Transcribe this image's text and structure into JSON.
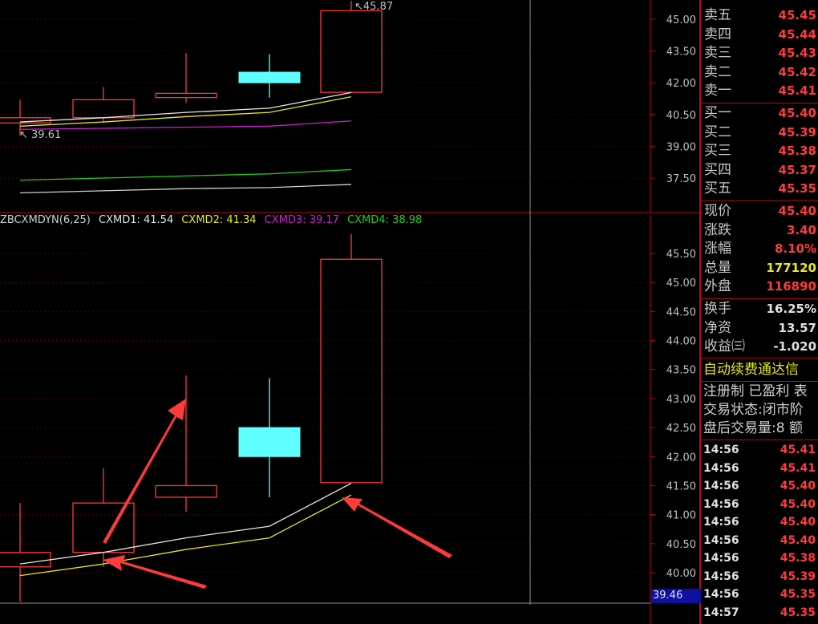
{
  "upper_chart": {
    "axis_ticks": [
      "45.00",
      "43.50",
      "42.00",
      "40.50",
      "39.00",
      "37.50"
    ],
    "high_label": "45.87",
    "low_label": "39.61"
  },
  "indicator": {
    "name": "ZBCXMDYN(6,25)",
    "series": [
      {
        "label": "CXMD1: 41.54",
        "color": "#e6e6e6"
      },
      {
        "label": "CXMD2: 41.34",
        "color": "#e8e818"
      },
      {
        "label": "CXMD3: 39.17",
        "color": "#d020d0"
      },
      {
        "label": "CXMD4: 38.98",
        "color": "#20d020"
      }
    ]
  },
  "lower_chart": {
    "axis_ticks": [
      "45.50",
      "45.00",
      "44.50",
      "44.00",
      "43.50",
      "43.00",
      "42.50",
      "42.00",
      "41.50",
      "41.00",
      "40.50",
      "40.00"
    ],
    "cursor_price": "39.46"
  },
  "chart_data": {
    "type": "candlestick",
    "candles": [
      {
        "open": 40.1,
        "close": 40.35,
        "high": 41.2,
        "low": 39.5,
        "color": "red"
      },
      {
        "open": 40.35,
        "close": 41.2,
        "high": 41.8,
        "low": 40.1,
        "color": "red"
      },
      {
        "open": 41.3,
        "close": 41.5,
        "high": 43.4,
        "low": 41.05,
        "color": "red"
      },
      {
        "open": 42.5,
        "close": 42.0,
        "high": 43.35,
        "low": 41.3,
        "color": "cyan"
      },
      {
        "open": 41.55,
        "close": 45.4,
        "high": 45.87,
        "low": 41.55,
        "color": "red"
      }
    ],
    "series": [
      {
        "name": "CXMD1",
        "values": [
          40.15,
          40.35,
          40.6,
          40.8,
          41.54
        ],
        "color": "#e6e6e6"
      },
      {
        "name": "CXMD2",
        "values": [
          39.95,
          40.15,
          40.4,
          40.6,
          41.34
        ],
        "color": "#e8e818"
      },
      {
        "name": "CXMD3",
        "values": [
          39.8,
          39.85,
          39.9,
          39.95,
          40.2
        ],
        "color": "#d020d0"
      },
      {
        "name": "CXMD4",
        "values": [
          37.4,
          37.5,
          37.6,
          37.7,
          37.9
        ],
        "color": "#20d020"
      },
      {
        "name": "",
        "values": [
          36.8,
          36.9,
          37.0,
          37.05,
          37.2
        ],
        "color": "#d0d0d0"
      }
    ],
    "upper_ylim": [
      37.0,
      46.0
    ],
    "lower_ylim": [
      39.7,
      45.9
    ]
  },
  "quotes": {
    "sell": [
      {
        "label": "卖五",
        "value": "45.45"
      },
      {
        "label": "卖四",
        "value": "45.44"
      },
      {
        "label": "卖三",
        "value": "45.43"
      },
      {
        "label": "卖二",
        "value": "45.42"
      },
      {
        "label": "卖一",
        "value": "45.41"
      }
    ],
    "buy": [
      {
        "label": "买一",
        "value": "45.40"
      },
      {
        "label": "买二",
        "value": "45.39"
      },
      {
        "label": "买三",
        "value": "45.38"
      },
      {
        "label": "买四",
        "value": "45.37"
      },
      {
        "label": "买五",
        "value": "45.35"
      }
    ],
    "stats1": [
      {
        "label": "现价",
        "value": "45.40",
        "color": "red"
      },
      {
        "label": "涨跌",
        "value": "3.40",
        "color": "red"
      },
      {
        "label": "涨幅",
        "value": "8.10%",
        "color": "red"
      },
      {
        "label": "总量",
        "value": "177120",
        "color": "yellow"
      },
      {
        "label": "外盘",
        "value": "116890",
        "color": "red"
      }
    ],
    "stats2": [
      {
        "label": "换手",
        "value": "16.25%",
        "color": "white"
      },
      {
        "label": "净资",
        "value": "13.57",
        "color": "white"
      },
      {
        "label": "收益㈢",
        "value": "-1.020",
        "color": "white"
      }
    ]
  },
  "info": {
    "promo": "自动续费通达信",
    "register": "注册制 已盈利 表",
    "trade_status": "交易状态:闭市阶",
    "after_hours": "盘后交易量:8 额"
  },
  "ticks": [
    {
      "time": "14:56",
      "price": "45.41"
    },
    {
      "time": "14:56",
      "price": "45.41"
    },
    {
      "time": "14:56",
      "price": "45.40"
    },
    {
      "time": "14:56",
      "price": "45.40"
    },
    {
      "time": "14:56",
      "price": "45.40"
    },
    {
      "time": "14:56",
      "price": "45.40"
    },
    {
      "time": "14:56",
      "price": "45.38"
    },
    {
      "time": "14:56",
      "price": "45.39"
    },
    {
      "time": "14:56",
      "price": "45.35"
    },
    {
      "time": "14:57",
      "price": "45.35"
    }
  ]
}
